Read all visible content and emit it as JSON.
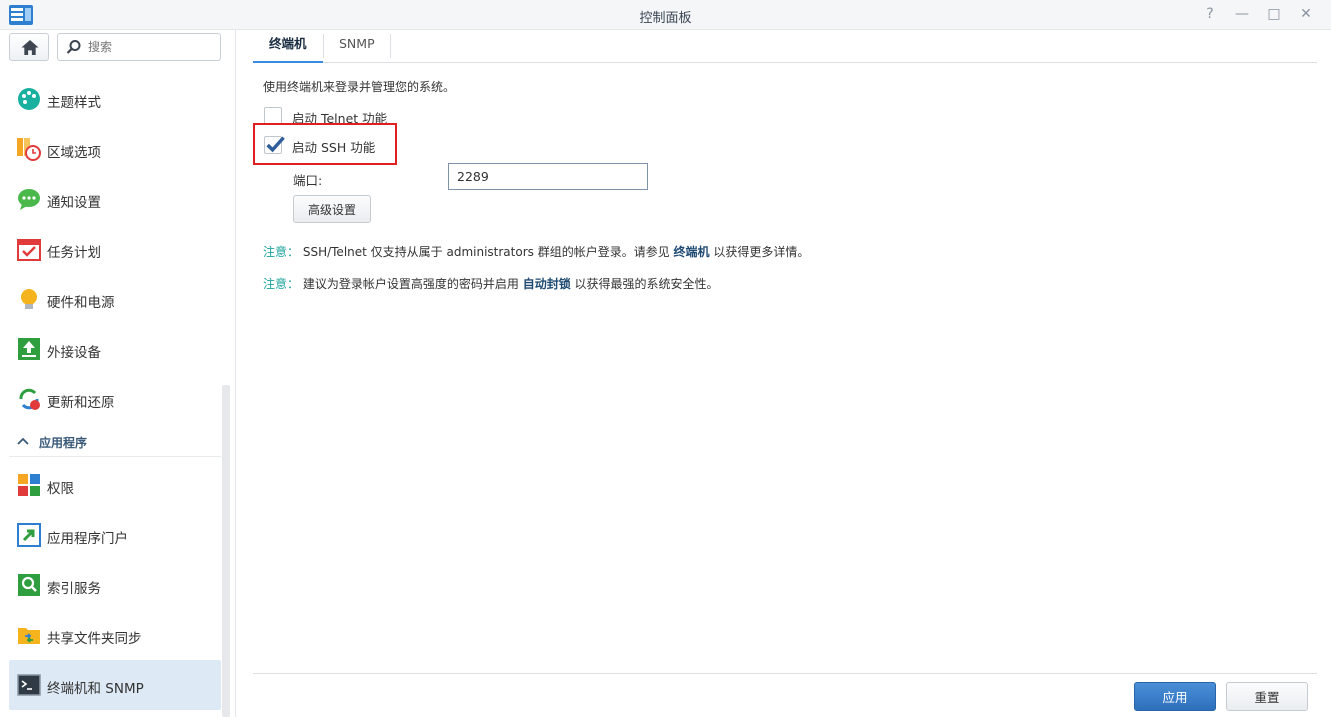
{
  "window": {
    "title": "控制面板",
    "help_icon": "?",
    "minimize_icon": "—",
    "restore_icon": "□",
    "close_icon": "✕"
  },
  "sidebar": {
    "search_placeholder": "搜索",
    "items": [
      {
        "label": "主题样式",
        "icon": "palette-icon"
      },
      {
        "label": "区域选项",
        "icon": "region-clock-icon"
      },
      {
        "label": "通知设置",
        "icon": "chat-bubble-icon"
      },
      {
        "label": "任务计划",
        "icon": "calendar-check-icon"
      },
      {
        "label": "硬件和电源",
        "icon": "lightbulb-icon"
      },
      {
        "label": "外接设备",
        "icon": "upload-arrow-icon"
      },
      {
        "label": "更新和还原",
        "icon": "refresh-icon"
      }
    ],
    "section_label": "应用程序",
    "app_items": [
      {
        "label": "权限",
        "icon": "grid-blocks-icon"
      },
      {
        "label": "应用程序门户",
        "icon": "portal-arrow-icon"
      },
      {
        "label": "索引服务",
        "icon": "magnifier-icon"
      },
      {
        "label": "共享文件夹同步",
        "icon": "folder-sync-icon"
      },
      {
        "label": "终端机和 SNMP",
        "icon": "terminal-icon"
      }
    ]
  },
  "tabs": [
    {
      "label": "终端机",
      "active": true
    },
    {
      "label": "SNMP",
      "active": false
    }
  ],
  "content": {
    "description": "使用终端机来登录并管理您的系统。",
    "telnet_label": "启动 Telnet 功能",
    "telnet_checked": false,
    "ssh_label": "启动 SSH 功能",
    "ssh_checked": true,
    "port_label": "端口:",
    "port_value": "2289",
    "advanced_button": "高级设置",
    "note1": {
      "tag": "注意：",
      "text_a": "SSH/Telnet 仅支持从属于 administrators 群组的帐户登录。请参见",
      "link": "终端机",
      "text_b": "以获得更多详情。"
    },
    "note2": {
      "tag": "注意：",
      "text_a": "建议为登录帐户设置高强度的密码并启用",
      "link": "自动封锁",
      "text_b": "以获得最强的系统安全性。"
    }
  },
  "footer": {
    "apply_label": "应用",
    "reset_label": "重置"
  },
  "colors": {
    "accent": "#3a8be0",
    "apply_button": "#2f6fbd",
    "note_tag": "#1aa39a",
    "highlight_box": "#e02020",
    "active_nav": "#dde9f5"
  }
}
